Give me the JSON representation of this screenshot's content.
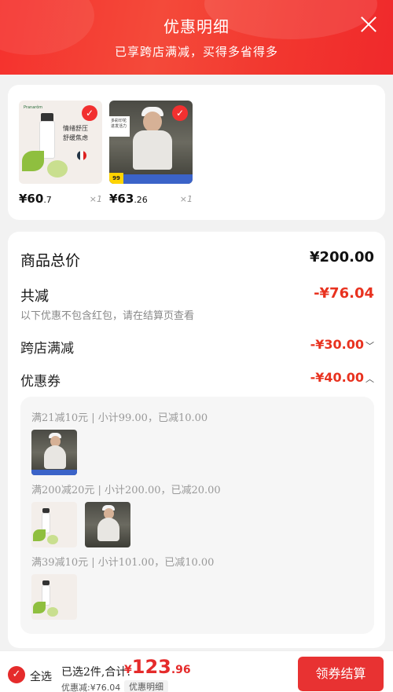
{
  "header": {
    "title": "优惠明细",
    "subtitle": "已享跨店满减，买得多省得多"
  },
  "products": [
    {
      "price_int": "¥60",
      "price_dec": ".7",
      "qty": "×1",
      "thumb_text1": "情绪舒压",
      "thumb_text2": "舒缓焦虑",
      "brand": "Pranarôm"
    },
    {
      "price_int": "¥63",
      "price_dec": ".26",
      "qty": "×1",
      "thumb_tag": "多彩印花 进发活力",
      "badge": "99"
    }
  ],
  "summary": {
    "total_label": "商品总价",
    "total_value": "¥200.00",
    "reduce_label": "共减",
    "reduce_value": "-¥76.04",
    "note": "以下优惠不包含红包，请在结算页查看",
    "cross_store_label": "跨店满减",
    "cross_store_value": "-¥30.00",
    "coupon_label": "优惠券",
    "coupon_value": "-¥40.00"
  },
  "coupon_groups": [
    {
      "title": "满21减10元 | 小计99.00，已减10.00"
    },
    {
      "title": "满200减20元 | 小计200.00，已减20.00"
    },
    {
      "title": "满39减10元 | 小计101.00，已减10.00"
    }
  ],
  "bottom": {
    "select_all": "全选",
    "selected_text": "已选2件,合计:",
    "total_currency": "¥",
    "total_int": "123",
    "total_dec": ".96",
    "discount_text": "优惠减:¥76.04",
    "detail_label": "优惠明细",
    "pay_label": "领券结算"
  },
  "colors": {
    "brand_red": "#f23030",
    "price_red": "#e8321f"
  }
}
